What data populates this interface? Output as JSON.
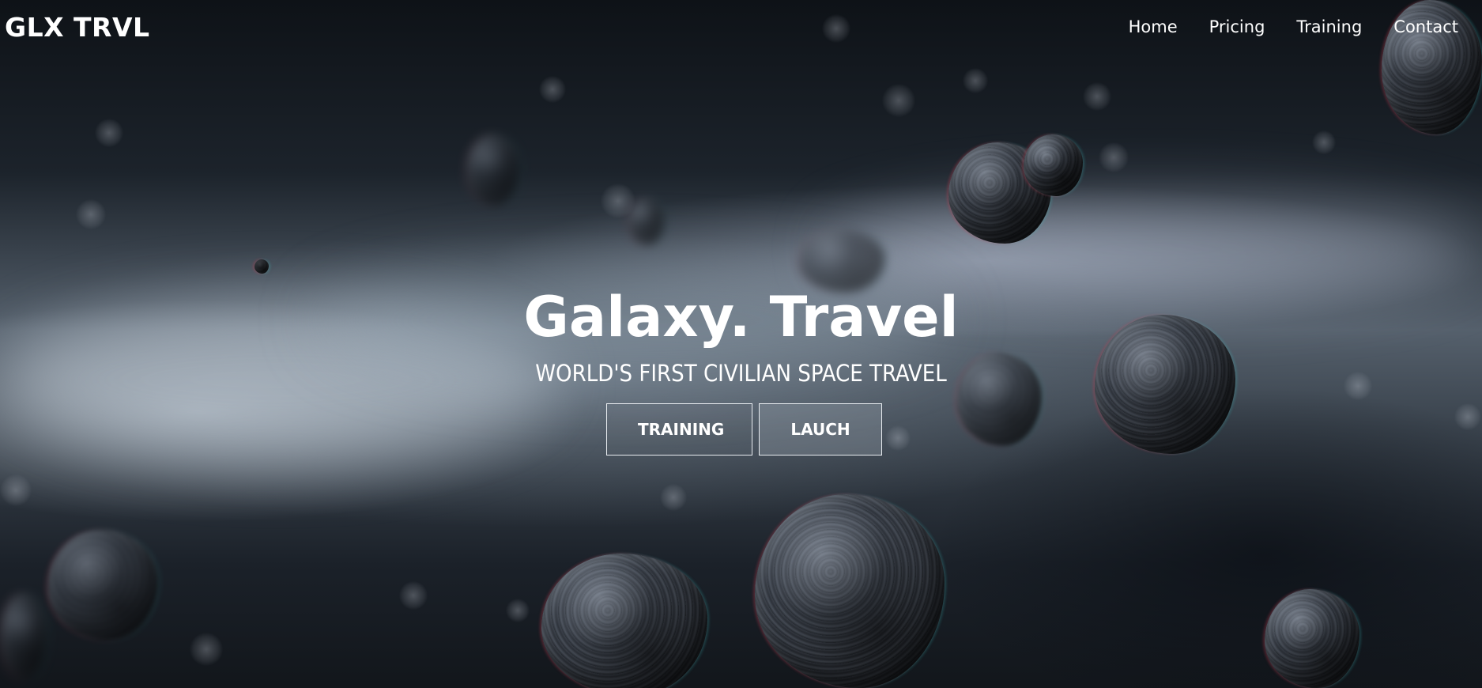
{
  "navbar": {
    "brand": "GLX TRVL",
    "links": [
      {
        "label": "Home"
      },
      {
        "label": "Pricing"
      },
      {
        "label": "Training"
      },
      {
        "label": "Contact"
      }
    ]
  },
  "hero": {
    "title": "Galaxy. Travel",
    "subtitle": "WORLD'S FIRST CIVILIAN SPACE TRAVEL",
    "buttons": {
      "training_label": "TRAINING",
      "launch_label": "LAUCH"
    }
  }
}
